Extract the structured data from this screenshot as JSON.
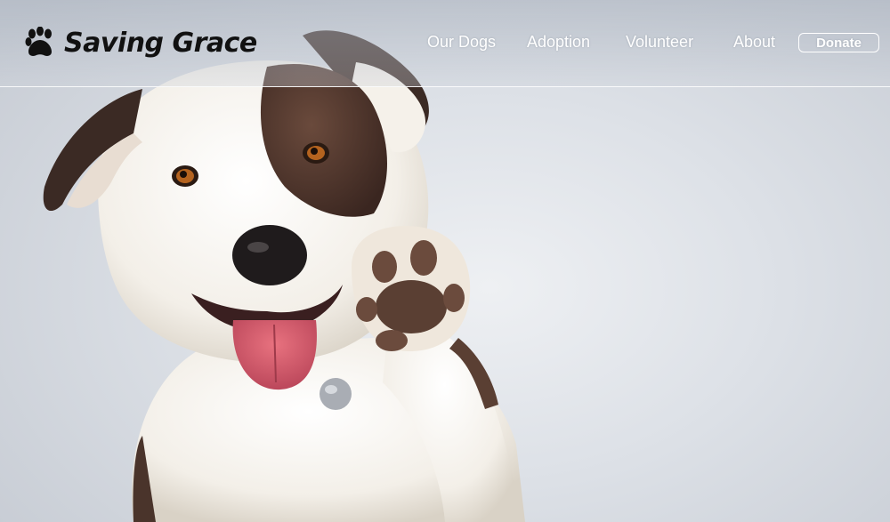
{
  "brand": {
    "name": "Saving Grace",
    "logo_icon": "paw-print-icon"
  },
  "nav": {
    "items": [
      {
        "label": "Our Dogs"
      },
      {
        "label": "Adoption"
      },
      {
        "label": "Volunteer"
      },
      {
        "label": "About"
      }
    ],
    "donate_label": "Donate"
  },
  "hero": {
    "image": "white-and-brown-dog-raising-paw"
  },
  "colors": {
    "background": "#dde1e7",
    "nav_text": "#ffffff",
    "brand_text": "#111111"
  }
}
